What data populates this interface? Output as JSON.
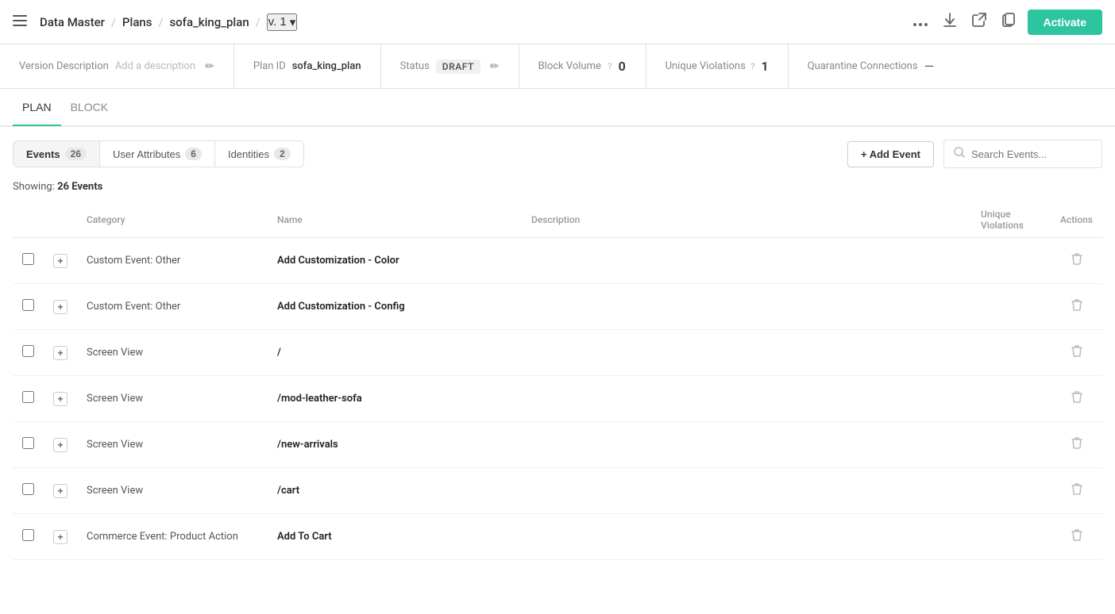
{
  "nav": {
    "menu_icon": "≡",
    "breadcrumbs": [
      "Data Master",
      "Plans",
      "sofa_king_plan"
    ],
    "version": "v. 1",
    "version_chevron": "▾",
    "actions": {
      "more_label": "•••",
      "download_label": "⬇",
      "export_label": "↗",
      "copy_label": "⧉",
      "activate_label": "Activate"
    }
  },
  "meta": {
    "version_desc_label": "Version Description",
    "version_desc_placeholder": "Add a description",
    "plan_id_label": "Plan ID",
    "plan_id_value": "sofa_king_plan",
    "status_label": "Status",
    "status_value": "DRAFT",
    "block_volume_label": "Block Volume",
    "block_volume_help": "?",
    "block_volume_value": "0",
    "unique_violations_label": "Unique Violations",
    "unique_violations_help": "?",
    "unique_violations_value": "1",
    "quarantine_connections_label": "Quarantine Connections",
    "quarantine_connections_value": "—"
  },
  "plan_tabs": [
    {
      "id": "plan",
      "label": "PLAN",
      "active": true
    },
    {
      "id": "block",
      "label": "BLOCK",
      "active": false
    }
  ],
  "events_toolbar": {
    "tabs": [
      {
        "id": "events",
        "label": "Events",
        "count": "26",
        "active": true
      },
      {
        "id": "user-attributes",
        "label": "User Attributes",
        "count": "6",
        "active": false
      },
      {
        "id": "identities",
        "label": "Identities",
        "count": "2",
        "active": false
      }
    ],
    "add_event_label": "+ Add Event",
    "search_placeholder": "Search Events..."
  },
  "showing": {
    "prefix": "Showing:",
    "value": "26 Events"
  },
  "table": {
    "headers": {
      "category": "Category",
      "name": "Name",
      "description": "Description",
      "unique_violations": "Unique Violations",
      "actions": "Actions"
    },
    "rows": [
      {
        "id": 1,
        "category": "Custom Event: Other",
        "name": "Add Customization - Color",
        "description": "",
        "unique_violations": ""
      },
      {
        "id": 2,
        "category": "Custom Event: Other",
        "name": "Add Customization - Config",
        "description": "",
        "unique_violations": ""
      },
      {
        "id": 3,
        "category": "Screen View",
        "name": "/",
        "description": "",
        "unique_violations": ""
      },
      {
        "id": 4,
        "category": "Screen View",
        "name": "/mod-leather-sofa",
        "description": "",
        "unique_violations": ""
      },
      {
        "id": 5,
        "category": "Screen View",
        "name": "/new-arrivals",
        "description": "",
        "unique_violations": ""
      },
      {
        "id": 6,
        "category": "Screen View",
        "name": "/cart",
        "description": "",
        "unique_violations": ""
      },
      {
        "id": 7,
        "category": "Commerce Event: Product Action",
        "name": "Add To Cart",
        "description": "",
        "unique_violations": ""
      }
    ]
  }
}
